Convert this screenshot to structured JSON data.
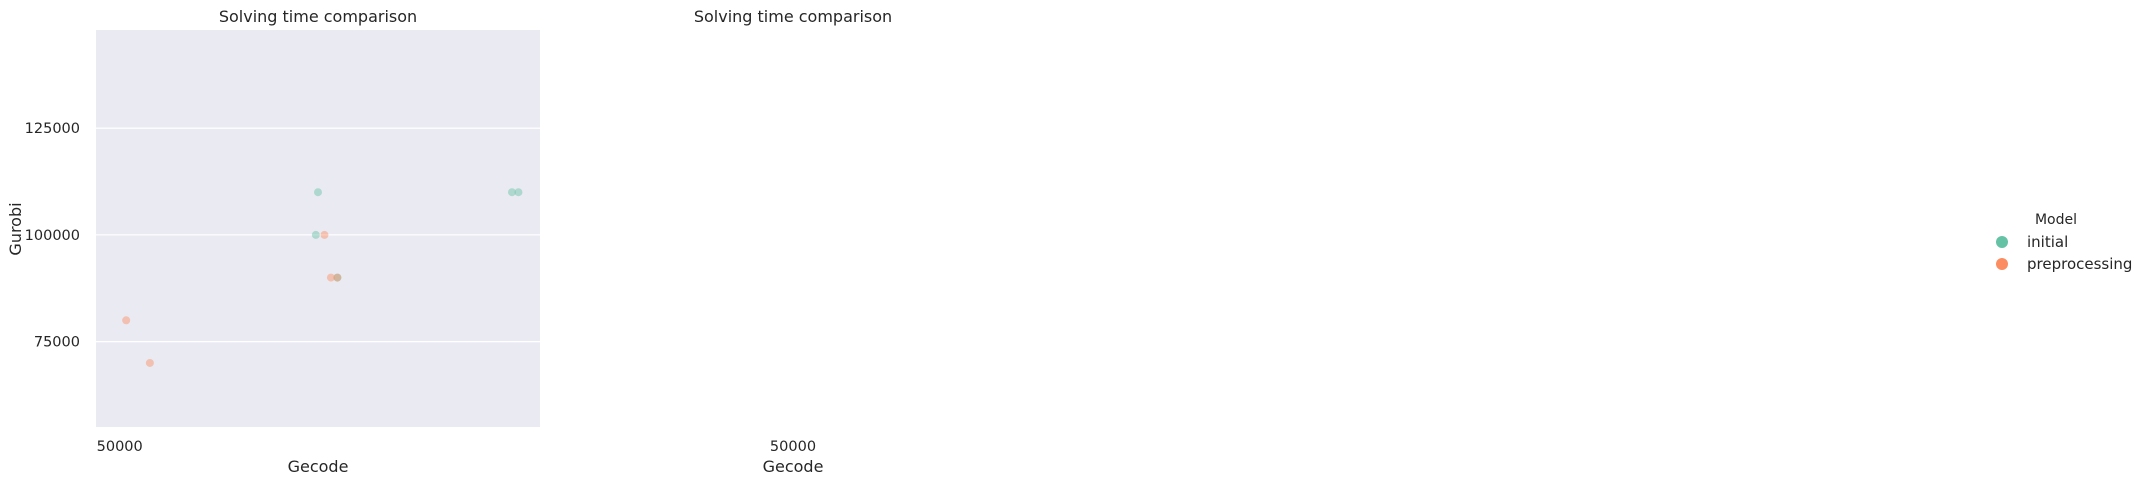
{
  "chart_data": [
    {
      "type": "scatter",
      "title": "Solving time comparison",
      "xlabel": "Gecode",
      "ylabel": "Gurobi",
      "x_ticks": [
        50000
      ],
      "y_ticks": [
        75000,
        100000,
        125000
      ],
      "xlim": [
        39000,
        245000
      ],
      "ylim": [
        55000,
        148000
      ],
      "grid": true,
      "series": [
        {
          "name": "initial",
          "color": "#66c2a5",
          "points": [
            {
              "x": 142000,
              "y": 110000
            },
            {
              "x": 141000,
              "y": 100000
            },
            {
              "x": 151000,
              "y": 90000
            },
            {
              "x": 232000,
              "y": 110000
            },
            {
              "x": 235000,
              "y": 110000
            }
          ]
        },
        {
          "name": "preprocessing",
          "color": "#fc8d62",
          "points": [
            {
              "x": 53000,
              "y": 80000
            },
            {
              "x": 64000,
              "y": 70000
            },
            {
              "x": 145000,
              "y": 100000
            },
            {
              "x": 148000,
              "y": 90000
            },
            {
              "x": 151000,
              "y": 90000
            }
          ]
        }
      ]
    },
    {
      "type": "scatter",
      "title": "Solving time comparison",
      "xlabel": "Gecode",
      "ylabel": "",
      "x_ticks": [
        50000
      ],
      "y_ticks": [],
      "series": []
    }
  ],
  "legend": {
    "title": "Model",
    "items": [
      {
        "label": "initial",
        "color": "#66c2a5"
      },
      {
        "label": "preprocessing",
        "color": "#fc8d62"
      }
    ]
  },
  "colors": {
    "plot_background": "#eaeaf2",
    "grid": "#ffffff"
  }
}
